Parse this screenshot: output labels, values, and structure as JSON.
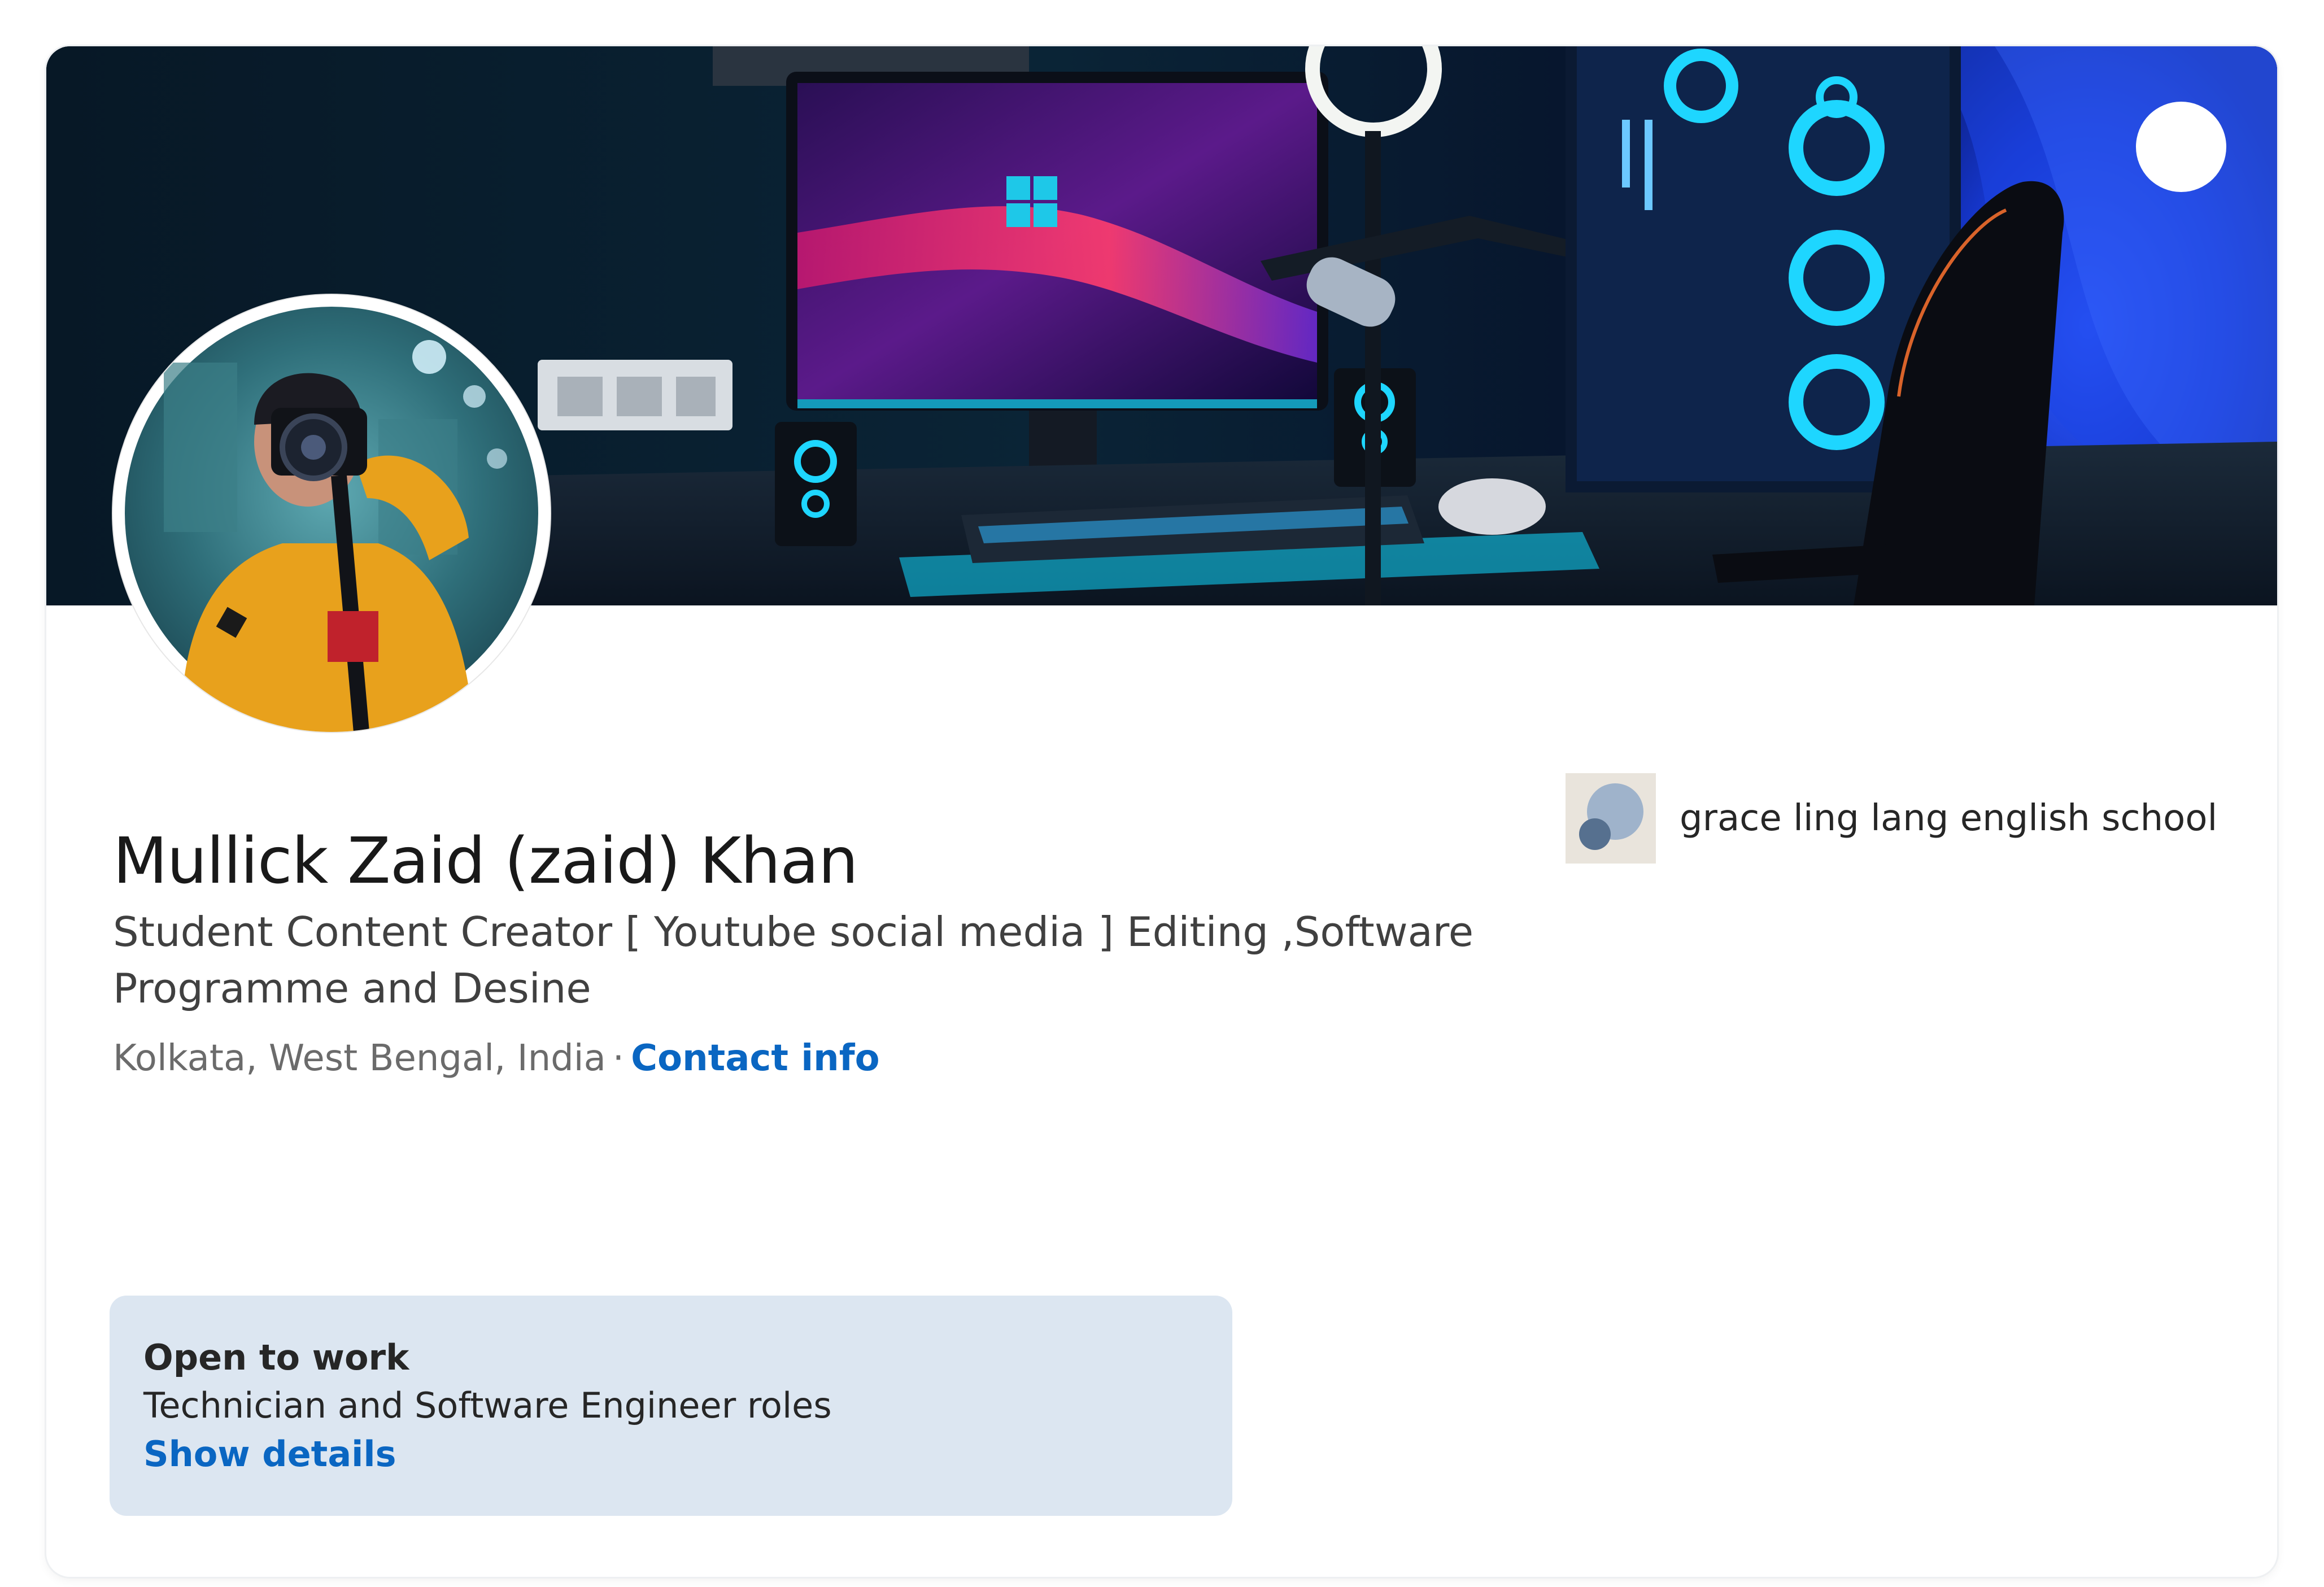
{
  "profile": {
    "name": "Mullick Zaid (zaid) Khan",
    "headline": "Student Content Creator [ Youtube social media ] Editing ,Software Programme and Desine",
    "location": "Kolkata, West Bengal, India",
    "separator": "·",
    "contact_info_label": "Contact info"
  },
  "education": {
    "school_name": "grace ling lang english school",
    "logo_icon": "school-logo-icon"
  },
  "open_to_work": {
    "title": "Open to work",
    "roles": "Technician and Software Engineer roles",
    "show_details_label": "Show details"
  },
  "colors": {
    "link": "#0a66c2",
    "open_to_work_bg": "#dce6f1",
    "avatar_hoodie": "#e8a11c"
  }
}
